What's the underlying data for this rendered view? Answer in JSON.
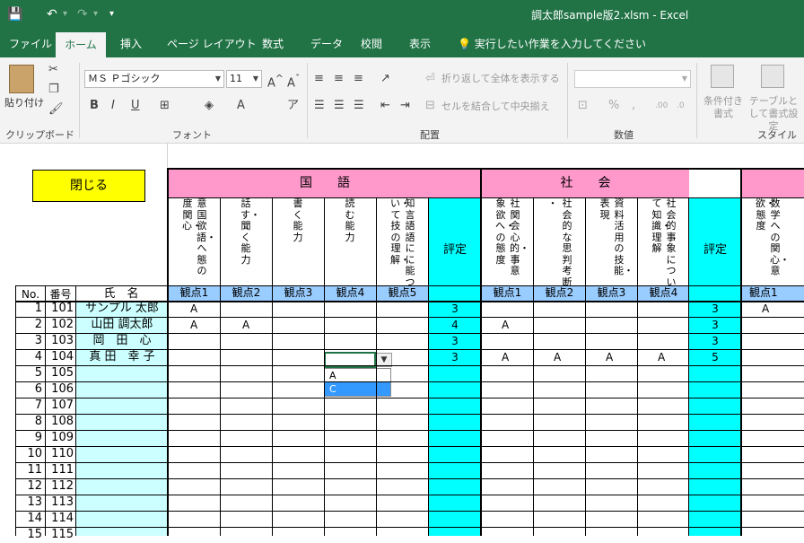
{
  "window": {
    "title": "調太郎sample版2.xlsm  -  Excel",
    "undo": "↶",
    "redo": "↷",
    "save": "💾",
    "customize": "▾"
  },
  "tabs": [
    "ファイル",
    "ホーム",
    "挿入",
    "ページ レイアウト",
    "数式",
    "データ",
    "校閲",
    "表示",
    "実行したい作業を入力してください"
  ],
  "ribbon": {
    "clipboard": {
      "paste": "貼り付け",
      "group": "クリップボード"
    },
    "font": {
      "name": "ＭＳ Ｐゴシック",
      "size": "11",
      "group": "フォント",
      "bold": "B",
      "italic": "I",
      "underline": "U"
    },
    "alignment": {
      "wrap": "折り返して全体を表示する",
      "merge": "セルを結合して中央揃え",
      "group": "配置"
    },
    "number": {
      "format": "",
      "percent": "%",
      "comma": ",",
      "group": "数値"
    },
    "styles": {
      "conditional": "条件付き書式",
      "table": "テーブルとして書式設定",
      "group": "スタイル"
    }
  },
  "sheet": {
    "close_button": "閉じる",
    "subjects": {
      "kokugo": "国　　語",
      "shakai": "社　　会"
    },
    "header": {
      "no": "No.",
      "ban": "番号",
      "name": "氏　名",
      "hyotei": "評定"
    },
    "kokugo_desc": [
      "意国欲語・へ態の度関心・",
      "話す・聞く能力",
      "書く能力",
      "読む能力",
      "知言語語にに能つい・て技の理解・"
    ],
    "shakai_desc": [
      "社関会心的・事意象欲へ・の態度",
      "社会的な思判考断・",
      "資料活用の技能・表現",
      "社会的事象について知識・理解"
    ],
    "math_desc": "数学への関心・意欲・態度",
    "kanten": [
      "観点1",
      "観点2",
      "観点3",
      "観点4",
      "観点5"
    ],
    "rows": [
      {
        "no": "1",
        "ban": "101",
        "name": "サンプル 太郎",
        "k": [
          "A",
          "",
          "",
          "",
          ""
        ],
        "kh": "3",
        "s": [
          "",
          "",
          "",
          ""
        ],
        "sh": "3",
        "m": "A"
      },
      {
        "no": "2",
        "ban": "102",
        "name": "山田 調太郎",
        "k": [
          "A",
          "A",
          "",
          "",
          ""
        ],
        "kh": "4",
        "s": [
          "A",
          "",
          "",
          ""
        ],
        "sh": "3",
        "m": ""
      },
      {
        "no": "3",
        "ban": "103",
        "name": "岡　田　心",
        "k": [
          "",
          "",
          "",
          "",
          ""
        ],
        "kh": "3",
        "s": [
          "",
          "",
          "",
          ""
        ],
        "sh": "3",
        "m": ""
      },
      {
        "no": "4",
        "ban": "104",
        "name": "真 田　幸 子",
        "k": [
          "",
          "",
          "",
          "",
          ""
        ],
        "kh": "3",
        "s": [
          "A",
          "A",
          "A",
          "A"
        ],
        "sh": "5",
        "m": ""
      },
      {
        "no": "5",
        "ban": "105",
        "name": "",
        "k": [
          "",
          "",
          "",
          "",
          ""
        ],
        "kh": "",
        "s": [
          "",
          "",
          "",
          ""
        ],
        "sh": "",
        "m": ""
      },
      {
        "no": "6",
        "ban": "106",
        "name": "",
        "k": [
          "",
          "",
          "",
          "",
          ""
        ],
        "kh": "",
        "s": [
          "",
          "",
          "",
          ""
        ],
        "sh": "",
        "m": ""
      },
      {
        "no": "7",
        "ban": "107",
        "name": "",
        "k": [
          "",
          "",
          "",
          "",
          ""
        ],
        "kh": "",
        "s": [
          "",
          "",
          "",
          ""
        ],
        "sh": "",
        "m": ""
      },
      {
        "no": "8",
        "ban": "108",
        "name": "",
        "k": [
          "",
          "",
          "",
          "",
          ""
        ],
        "kh": "",
        "s": [
          "",
          "",
          "",
          ""
        ],
        "sh": "",
        "m": ""
      },
      {
        "no": "9",
        "ban": "109",
        "name": "",
        "k": [
          "",
          "",
          "",
          "",
          ""
        ],
        "kh": "",
        "s": [
          "",
          "",
          "",
          ""
        ],
        "sh": "",
        "m": ""
      },
      {
        "no": "10",
        "ban": "110",
        "name": "",
        "k": [
          "",
          "",
          "",
          "",
          ""
        ],
        "kh": "",
        "s": [
          "",
          "",
          "",
          ""
        ],
        "sh": "",
        "m": ""
      },
      {
        "no": "11",
        "ban": "111",
        "name": "",
        "k": [
          "",
          "",
          "",
          "",
          ""
        ],
        "kh": "",
        "s": [
          "",
          "",
          "",
          ""
        ],
        "sh": "",
        "m": ""
      },
      {
        "no": "12",
        "ban": "112",
        "name": "",
        "k": [
          "",
          "",
          "",
          "",
          ""
        ],
        "kh": "",
        "s": [
          "",
          "",
          "",
          ""
        ],
        "sh": "",
        "m": ""
      },
      {
        "no": "13",
        "ban": "113",
        "name": "",
        "k": [
          "",
          "",
          "",
          "",
          ""
        ],
        "kh": "",
        "s": [
          "",
          "",
          "",
          ""
        ],
        "sh": "",
        "m": ""
      },
      {
        "no": "14",
        "ban": "114",
        "name": "",
        "k": [
          "",
          "",
          "",
          "",
          ""
        ],
        "kh": "",
        "s": [
          "",
          "",
          "",
          ""
        ],
        "sh": "",
        "m": ""
      },
      {
        "no": "15",
        "ban": "115",
        "name": "",
        "k": [
          "",
          "",
          "",
          "",
          ""
        ],
        "kh": "",
        "s": [
          "",
          "",
          "",
          ""
        ],
        "sh": "",
        "m": ""
      }
    ],
    "dropdown": {
      "options": [
        "A",
        "C"
      ],
      "selected": "C"
    }
  },
  "colors": {
    "excel_green": "#217346",
    "pink": "#ff99cc",
    "cyan": "#00ffff",
    "light_cyan": "#ccffff",
    "kanten_blue": "#99ccff",
    "yellow": "#ffff00"
  }
}
